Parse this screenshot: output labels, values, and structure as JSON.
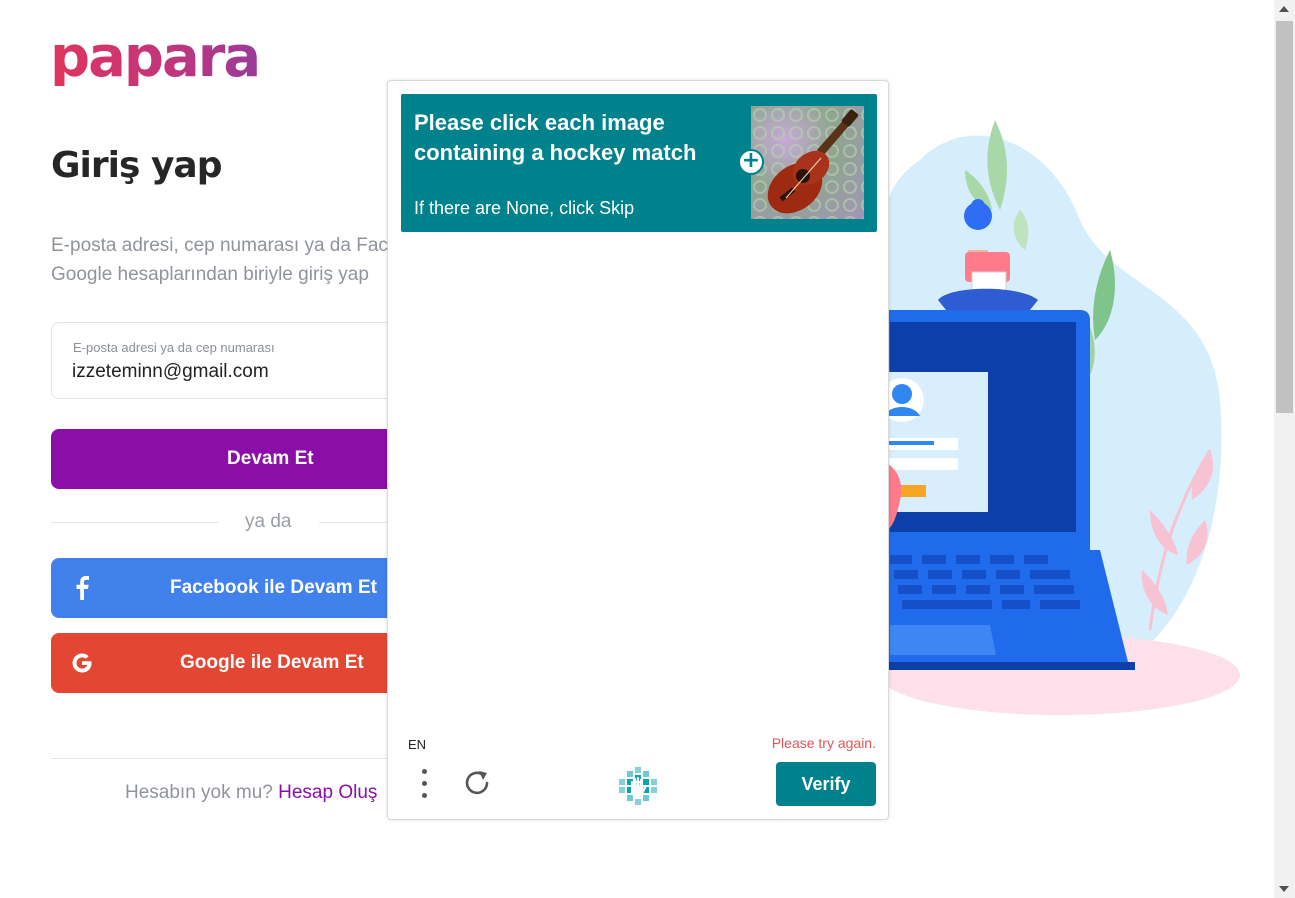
{
  "brand": {
    "logo_text": "papara"
  },
  "login": {
    "title": "Giriş yap",
    "subtitle_line1": "E-posta adresi, cep numarası ya da Facebook,",
    "subtitle_line2": "Google hesaplarından biriyle giriş yap",
    "email_label": "E-posta adresi ya da cep numarası",
    "email_value": "izzeteminn@gmail.com",
    "continue_button": "Devam Et",
    "divider_text": "ya da",
    "facebook_button": "Facebook ile Devam Et",
    "google_button": "Google ile Devam Et",
    "no_account_text": "Hesabın yok mu?",
    "create_account_link": "Hesap Oluş"
  },
  "captcha": {
    "prompt": "Please click each image containing a hockey match",
    "skip_hint": "If there are None, click Skip",
    "language": "EN",
    "error_text": "Please try again.",
    "verify_button": "Verify"
  },
  "icons": {
    "facebook": "facebook-icon",
    "google": "google-icon",
    "menu": "kebab-menu-icon",
    "refresh": "refresh-icon",
    "captcha_logo": "hcaptcha-logo-icon",
    "expand": "plus-icon"
  },
  "colors": {
    "brand_gradient_start": "#e0355c",
    "brand_gradient_end": "#9b3a9b",
    "continue_button": "#8c0ea9",
    "facebook_button": "#4081ec",
    "google_button": "#e34733",
    "captcha_teal": "#00828c",
    "captcha_error": "#e05555"
  }
}
